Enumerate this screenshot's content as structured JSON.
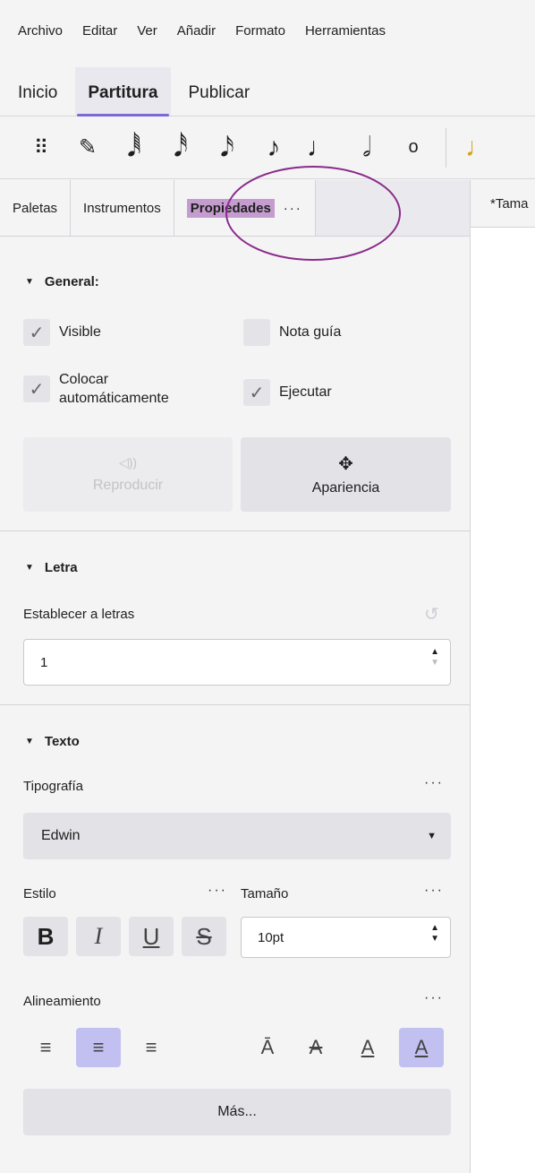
{
  "menu": [
    "Archivo",
    "Editar",
    "Ver",
    "Añadir",
    "Formato",
    "Herramientas"
  ],
  "main_tabs": [
    {
      "label": "Inicio"
    },
    {
      "label": "Partitura",
      "active": true
    },
    {
      "label": "Publicar"
    }
  ],
  "toolbar": {
    "icons": [
      "drag-handle-icon",
      "pencil-icon",
      "sixty-fourth-note-icon",
      "thirty-second-note-icon",
      "sixteenth-note-icon",
      "eighth-note-icon",
      "quarter-note-icon",
      "half-note-icon",
      "whole-note-icon"
    ]
  },
  "panel_tabs": [
    {
      "label": "Paletas"
    },
    {
      "label": "Instrumentos"
    },
    {
      "label": "Propiedades",
      "active": true,
      "dots": "···"
    }
  ],
  "score_tab": "*Tama",
  "general": {
    "title": "General:",
    "visible": {
      "label": "Visible",
      "checked": true
    },
    "nota_guia": {
      "label": "Nota guía",
      "checked": false
    },
    "colocar": {
      "label1": "Colocar",
      "label2": "automáticamente",
      "checked": true
    },
    "ejecutar": {
      "label": "Ejecutar",
      "checked": true
    },
    "reproducir": {
      "label": "Reproducir",
      "enabled": false
    },
    "apariencia": {
      "label": "Apariencia"
    }
  },
  "letra": {
    "title": "Letra",
    "establecer_label": "Establecer a letras",
    "value": "1"
  },
  "texto": {
    "title": "Texto",
    "tipografia_label": "Tipografía",
    "font_value": "Edwin",
    "estilo_label": "Estilo",
    "tamano_label": "Tamaño",
    "size_value": "10pt",
    "style_buttons": [
      "B",
      "I",
      "U",
      "S"
    ],
    "alineamiento_label": "Alineamiento",
    "mas_label": "Más...",
    "dots": "···"
  },
  "colors": {
    "accent": "#7b6ad6",
    "highlight": "#c59ccf",
    "selected": "#c2c0f0",
    "annotation": "#8a2b8a"
  }
}
